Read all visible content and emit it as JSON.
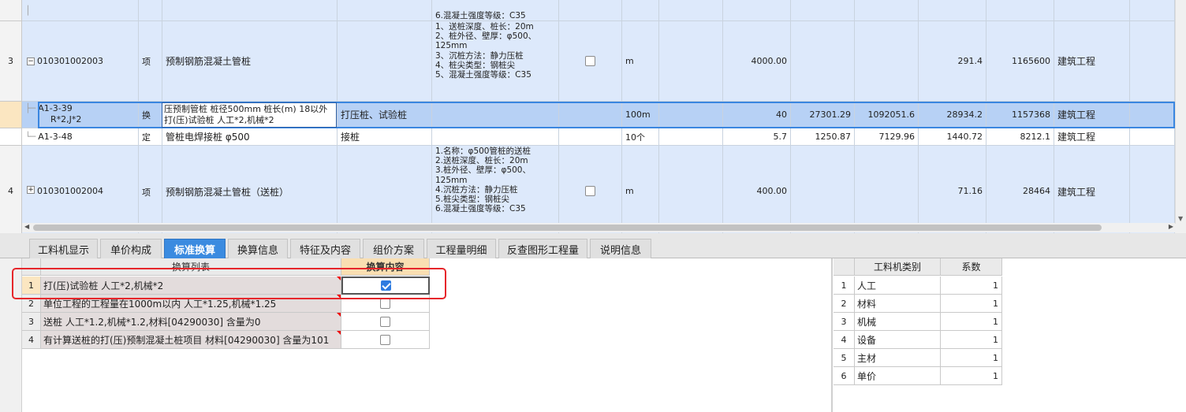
{
  "grid": {
    "row_prev_tail": "6.混凝土强度等级：C35",
    "row3": {
      "num": "3",
      "code": "010301002003",
      "type": "项",
      "name": "预制钢筋混凝土管桩",
      "features": "1、送桩深度、桩长：20m\n2、桩外径、壁厚：φ500、125mm\n3、沉桩方法：静力压桩\n4、桩尖类型：钢桩尖\n5、混凝土强度等级：C35",
      "unit": "m",
      "qty": "4000.00",
      "price": "291.4",
      "total": "1165600",
      "category": "建筑工程"
    },
    "row_a1": {
      "code1": "A1-3-39",
      "code2": "R*2,J*2",
      "type": "换",
      "name": "压预制管桩 桩径500mm 桩长(m) 18以外 打(压)试验桩 人工*2,机械*2",
      "work": "打压桩、试验桩",
      "unit": "100m",
      "qty": "40",
      "v1": "27301.29",
      "v2": "1092051.6",
      "price": "28934.2",
      "total": "1157368",
      "category": "建筑工程"
    },
    "row_a2": {
      "code": "A1-3-48",
      "type": "定",
      "name": "管桩电焊接桩 φ500",
      "work": "接桩",
      "unit": "10个",
      "qty": "5.7",
      "v1": "1250.87",
      "v2": "7129.96",
      "price": "1440.72",
      "total": "8212.1",
      "category": "建筑工程"
    },
    "row4": {
      "num": "4",
      "code": "010301002004",
      "type": "项",
      "name": "预制钢筋混凝土管桩（送桩）",
      "features": "1.名称：φ500管桩的送桩\n2.送桩深度、桩长：20m\n3.桩外径、壁厚：φ500、125mm\n4.沉桩方法：静力压桩\n5.桩尖类型：钢桩尖\n6.混凝土强度等级：C35",
      "unit": "m",
      "qty": "400.00",
      "price": "71.16",
      "total": "28464",
      "category": "建筑工程"
    }
  },
  "tabs": [
    {
      "label": "工料机显示"
    },
    {
      "label": "单价构成"
    },
    {
      "label": "标准换算"
    },
    {
      "label": "换算信息"
    },
    {
      "label": "特征及内容"
    },
    {
      "label": "组价方案"
    },
    {
      "label": "工程量明细"
    },
    {
      "label": "反查图形工程量"
    },
    {
      "label": "说明信息"
    }
  ],
  "conversion": {
    "col_list": "换算列表",
    "col_content": "换算内容",
    "rows": [
      {
        "num": "1",
        "label": "打(压)试验桩 人工*2,机械*2"
      },
      {
        "num": "2",
        "label": "单位工程的工程量在1000m以内 人工*1.25,机械*1.25"
      },
      {
        "num": "3",
        "label": "送桩 人工*1.2,机械*1.2,材料[04290030] 含量为0"
      },
      {
        "num": "4",
        "label": "有计算送桩的打(压)预制混凝土桩项目 材料[04290030] 含量为101"
      }
    ]
  },
  "coef": {
    "col_type": "工料机类别",
    "col_coef": "系数",
    "rows": [
      {
        "num": "1",
        "type": "人工",
        "value": "1"
      },
      {
        "num": "2",
        "type": "材料",
        "value": "1"
      },
      {
        "num": "3",
        "type": "机械",
        "value": "1"
      },
      {
        "num": "4",
        "type": "设备",
        "value": "1"
      },
      {
        "num": "5",
        "type": "主材",
        "value": "1"
      },
      {
        "num": "6",
        "type": "单价",
        "value": "1"
      }
    ]
  }
}
